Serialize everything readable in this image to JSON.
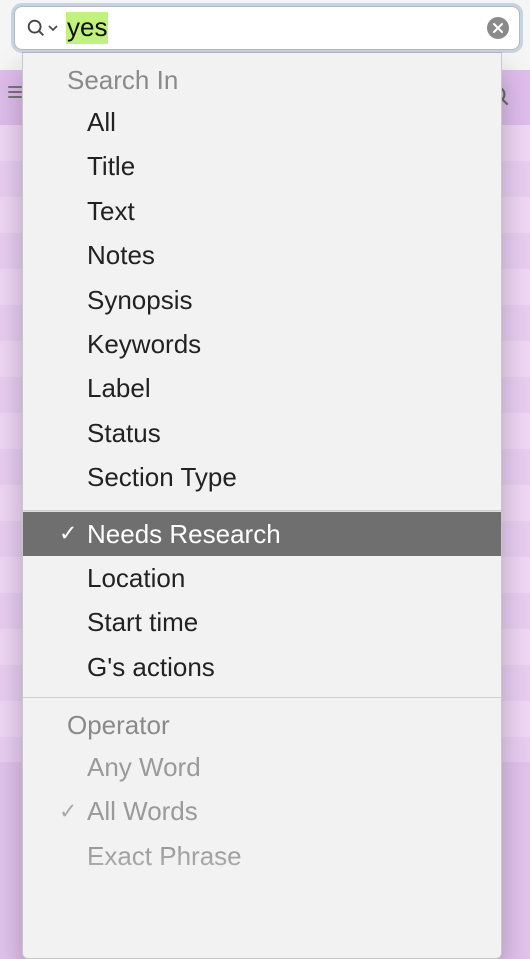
{
  "search": {
    "value": "yes",
    "placeholder": ""
  },
  "menu": {
    "sections": [
      {
        "header": "Search In",
        "items": [
          {
            "label": "All",
            "checked": false,
            "selected": false
          },
          {
            "label": "Title",
            "checked": false,
            "selected": false
          },
          {
            "label": "Text",
            "checked": false,
            "selected": false
          },
          {
            "label": "Notes",
            "checked": false,
            "selected": false
          },
          {
            "label": "Synopsis",
            "checked": false,
            "selected": false
          },
          {
            "label": "Keywords",
            "checked": false,
            "selected": false
          },
          {
            "label": "Label",
            "checked": false,
            "selected": false
          },
          {
            "label": "Status",
            "checked": false,
            "selected": false
          },
          {
            "label": "Section Type",
            "checked": false,
            "selected": false
          }
        ]
      },
      {
        "header": null,
        "items": [
          {
            "label": "Needs Research",
            "checked": true,
            "selected": true
          },
          {
            "label": "Location",
            "checked": false,
            "selected": false
          },
          {
            "label": "Start time",
            "checked": false,
            "selected": false
          },
          {
            "label": "G's actions",
            "checked": false,
            "selected": false
          }
        ]
      },
      {
        "header": "Operator",
        "items": [
          {
            "label": "Any Word",
            "checked": false,
            "selected": false,
            "dim": true
          },
          {
            "label": "All Words",
            "checked": true,
            "selected": false,
            "dim": true
          },
          {
            "label": "Exact Phrase",
            "checked": false,
            "selected": false,
            "dim": true
          }
        ]
      }
    ]
  },
  "colors": {
    "highlight_bg": "#c1f27d",
    "menu_selected_bg": "#6f6f6f"
  }
}
